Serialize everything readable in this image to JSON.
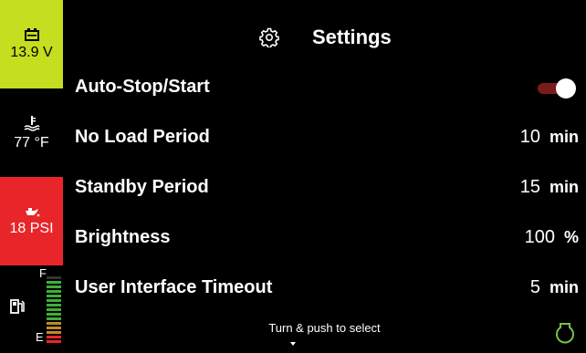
{
  "sidebar": {
    "battery": {
      "icon": "battery-icon",
      "value": "13.9 V",
      "color": "#c5de1f"
    },
    "coolant": {
      "icon": "coolant-temperature-icon",
      "value": "77 °F"
    },
    "oil": {
      "icon": "oil-pressure-icon",
      "value": "18 PSI",
      "color": "#e8262a"
    },
    "fuel": {
      "icon": "fuel-pump-icon",
      "full_label": "F",
      "empty_label": "E",
      "level": 0.9
    }
  },
  "header": {
    "icon": "gear-icon",
    "title": "Settings"
  },
  "settings": {
    "auto_stop_start": {
      "label": "Auto-Stop/Start",
      "enabled": true
    },
    "no_load_period": {
      "label": "No Load Period",
      "value": "10",
      "unit": "min"
    },
    "standby_period": {
      "label": "Standby Period",
      "value": "15",
      "unit": "min"
    },
    "brightness": {
      "label": "Brightness",
      "value": "100",
      "unit": "%"
    },
    "ui_timeout": {
      "label": "User Interface Timeout",
      "value": "5",
      "unit": "min"
    }
  },
  "footer": {
    "hint": "Turn & push to select",
    "knob_icon": "rotary-knob-icon"
  }
}
